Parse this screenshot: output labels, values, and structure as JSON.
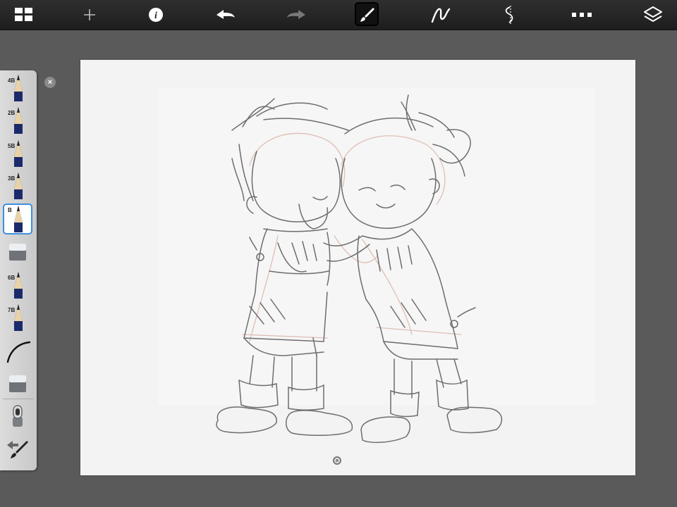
{
  "toolbar": {
    "items": [
      {
        "name": "gallery-grid-icon"
      },
      {
        "name": "new-sketch-plus-icon"
      },
      {
        "name": "info-icon"
      },
      {
        "name": "undo-arrow-icon"
      },
      {
        "name": "redo-arrow-icon"
      },
      {
        "name": "brush-icon",
        "active": true
      },
      {
        "name": "stroke-curve-icon"
      },
      {
        "name": "symmetry-icon"
      },
      {
        "name": "more-menu-icon"
      },
      {
        "name": "layers-icon"
      }
    ]
  },
  "brush_panel": {
    "brushes": [
      {
        "label": "4B",
        "icon": "pencil-icon"
      },
      {
        "label": "2B",
        "icon": "pencil-icon"
      },
      {
        "label": "5B",
        "icon": "pencil-icon"
      },
      {
        "label": "3B",
        "icon": "pencil-icon"
      },
      {
        "label": "B",
        "icon": "pencil-icon",
        "selected": true
      },
      {
        "label": "",
        "icon": "eraser-block-icon"
      },
      {
        "label": "6B",
        "icon": "pencil-icon"
      },
      {
        "label": "7B",
        "icon": "pencil-icon"
      },
      {
        "label": "",
        "icon": "ink-stroke-icon"
      },
      {
        "label": "",
        "icon": "eraser-block-icon"
      },
      {
        "label": "",
        "icon": "smudge-tool-icon"
      },
      {
        "label": "",
        "icon": "brush-swap-icon"
      }
    ],
    "close_icon": "×"
  },
  "colors": {
    "toolbar_bg": "#222222",
    "workspace_bg": "#5a5a5a",
    "canvas_bg": "#f3f3f3",
    "selection_accent": "#3d8fe0"
  }
}
